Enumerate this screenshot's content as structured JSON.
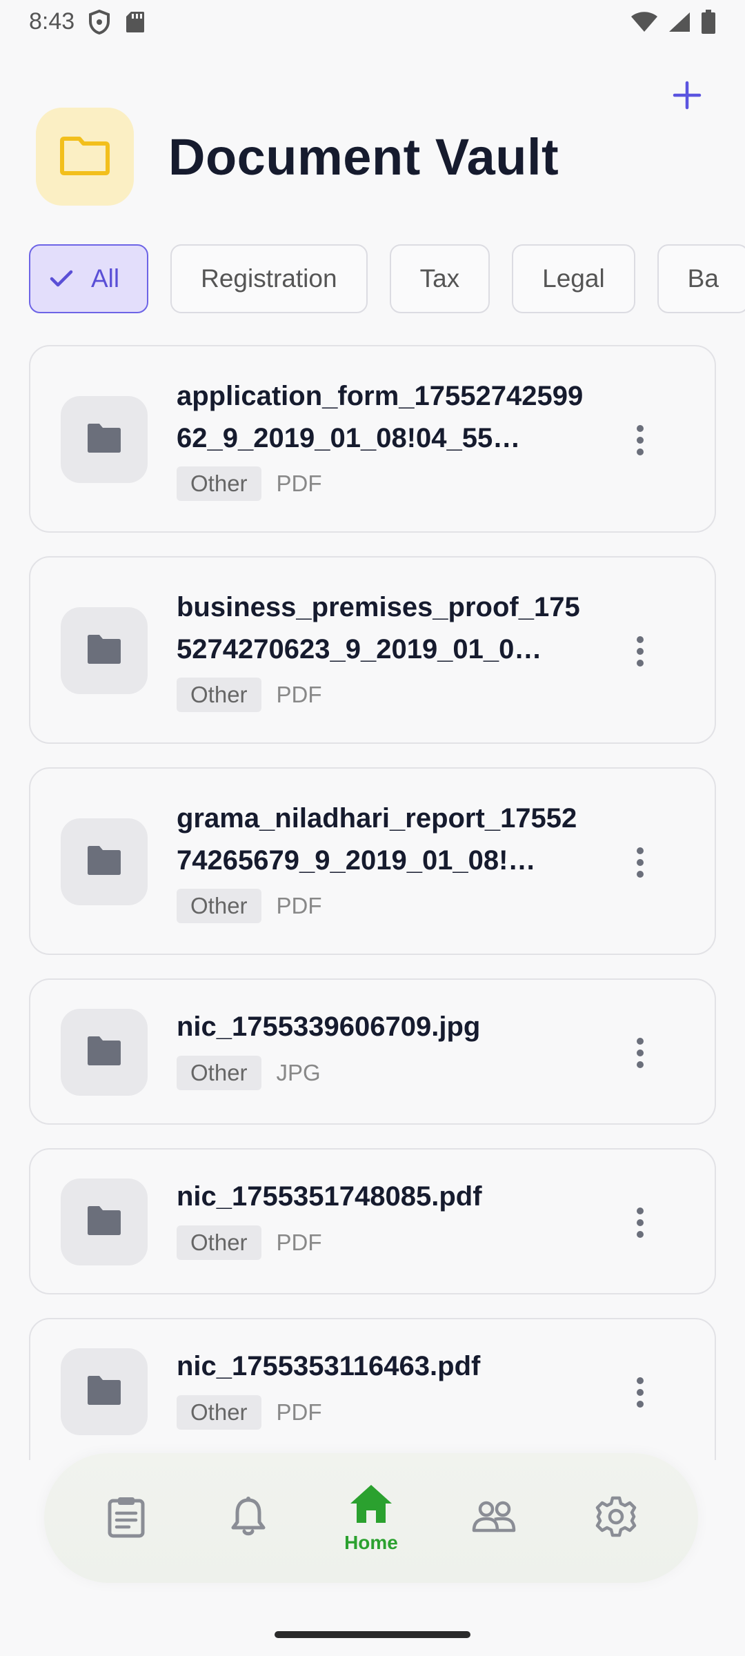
{
  "status_bar": {
    "time": "8:43",
    "icons": [
      "shield-icon",
      "sd-card-icon",
      "wifi-icon",
      "signal-icon",
      "battery-icon"
    ]
  },
  "header": {
    "title": "Document Vault",
    "icon": "folder-icon",
    "add_icon": "plus-icon"
  },
  "filters": {
    "chips": [
      {
        "label": "All",
        "active": true
      },
      {
        "label": "Registration",
        "active": false
      },
      {
        "label": "Tax",
        "active": false
      },
      {
        "label": "Legal",
        "active": false
      },
      {
        "label": "Ba",
        "active": false
      }
    ]
  },
  "documents": [
    {
      "name": "application_form_1755274259962_9_2019_01_08!04_55…",
      "category": "Other",
      "type": "PDF"
    },
    {
      "name": "business_premises_proof_1755274270623_9_2019_01_0…",
      "category": "Other",
      "type": "PDF"
    },
    {
      "name": "grama_niladhari_report_1755274265679_9_2019_01_08!…",
      "category": "Other",
      "type": "PDF"
    },
    {
      "name": "nic_1755339606709.jpg",
      "category": "Other",
      "type": "JPG"
    },
    {
      "name": "nic_1755351748085.pdf",
      "category": "Other",
      "type": "PDF"
    },
    {
      "name": "nic_1755353116463.pdf",
      "category": "Other",
      "type": "PDF"
    }
  ],
  "bottom_nav": {
    "items": [
      {
        "icon": "clipboard-icon",
        "label": ""
      },
      {
        "icon": "bell-icon",
        "label": ""
      },
      {
        "icon": "home-icon",
        "label": "Home",
        "active": true
      },
      {
        "icon": "people-icon",
        "label": ""
      },
      {
        "icon": "gear-icon",
        "label": ""
      }
    ]
  },
  "colors": {
    "accent": "#6d64e6",
    "active_nav": "#2ba12f",
    "folder_badge": "#fbefc4",
    "folder_icon": "#f2bf1c"
  }
}
